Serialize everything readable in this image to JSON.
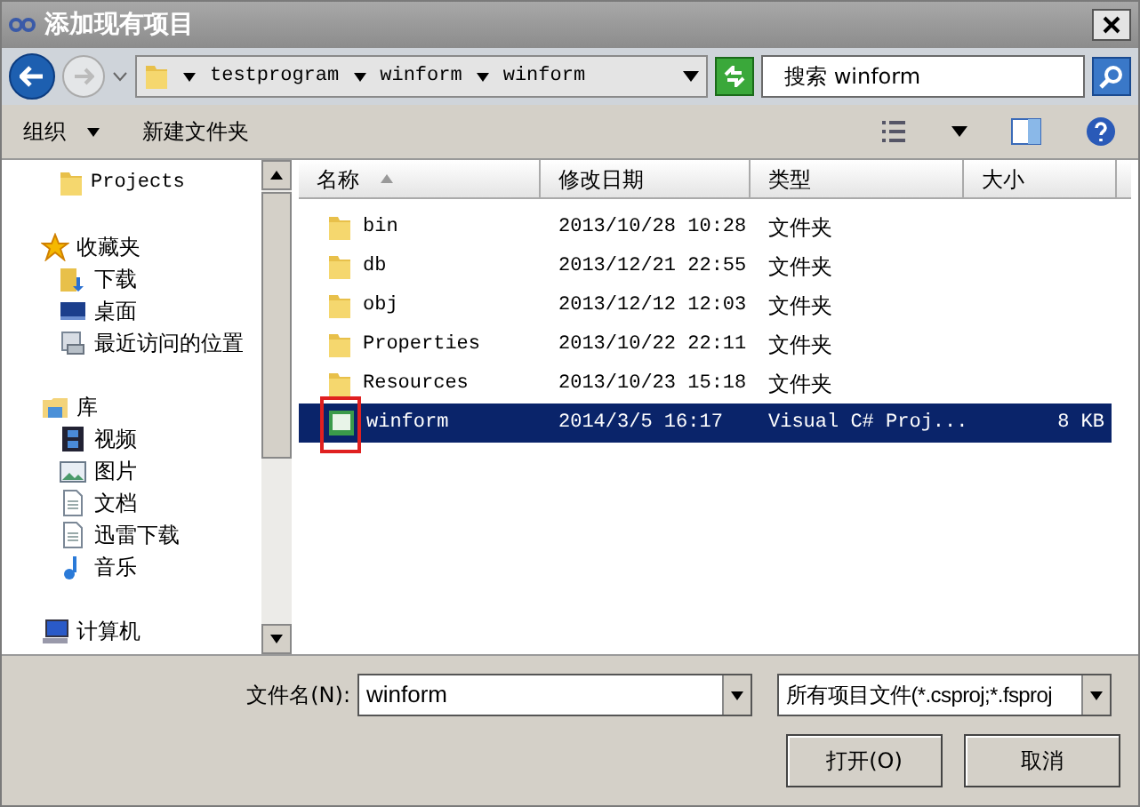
{
  "window": {
    "title": "添加现有项目"
  },
  "address": {
    "crumbs": [
      "testprogram",
      "winform",
      "winform"
    ]
  },
  "search": {
    "placeholder": "搜索 winform"
  },
  "toolbar": {
    "organize": "组织",
    "new_folder": "新建文件夹"
  },
  "sidebar": {
    "items": [
      {
        "label": "Projects",
        "kind": "folder"
      },
      {
        "label": "收藏夹",
        "kind": "star",
        "children": [
          {
            "label": "下载",
            "kind": "download"
          },
          {
            "label": "桌面",
            "kind": "desktop"
          },
          {
            "label": "最近访问的位置",
            "kind": "recent"
          }
        ]
      },
      {
        "label": "库",
        "kind": "library",
        "children": [
          {
            "label": "视频",
            "kind": "video"
          },
          {
            "label": "图片",
            "kind": "image"
          },
          {
            "label": "文档",
            "kind": "document"
          },
          {
            "label": "迅雷下载",
            "kind": "document"
          },
          {
            "label": "音乐",
            "kind": "music"
          }
        ]
      },
      {
        "label": "计算机",
        "kind": "computer"
      }
    ]
  },
  "table": {
    "columns": [
      "名称",
      "修改日期",
      "类型",
      "大小"
    ],
    "rows": [
      {
        "name": "bin",
        "date": "2013/10/28 10:28",
        "type": "文件夹",
        "size": "",
        "kind": "folder",
        "selected": false
      },
      {
        "name": "db",
        "date": "2013/12/21 22:55",
        "type": "文件夹",
        "size": "",
        "kind": "folder",
        "selected": false
      },
      {
        "name": "obj",
        "date": "2013/12/12 12:03",
        "type": "文件夹",
        "size": "",
        "kind": "folder",
        "selected": false
      },
      {
        "name": "Properties",
        "date": "2013/10/22 22:11",
        "type": "文件夹",
        "size": "",
        "kind": "folder",
        "selected": false
      },
      {
        "name": "Resources",
        "date": "2013/10/23 15:18",
        "type": "文件夹",
        "size": "",
        "kind": "folder",
        "selected": false
      },
      {
        "name": "winform",
        "date": "2014/3/5 16:17",
        "type": "Visual C# Proj...",
        "size": "8 KB",
        "kind": "project",
        "selected": true
      }
    ]
  },
  "footer": {
    "filename_label": "文件名(N):",
    "filename": "winform",
    "filter": "所有项目文件(*.csproj;*.fsproj",
    "open": "打开(O)",
    "cancel": "取消"
  }
}
